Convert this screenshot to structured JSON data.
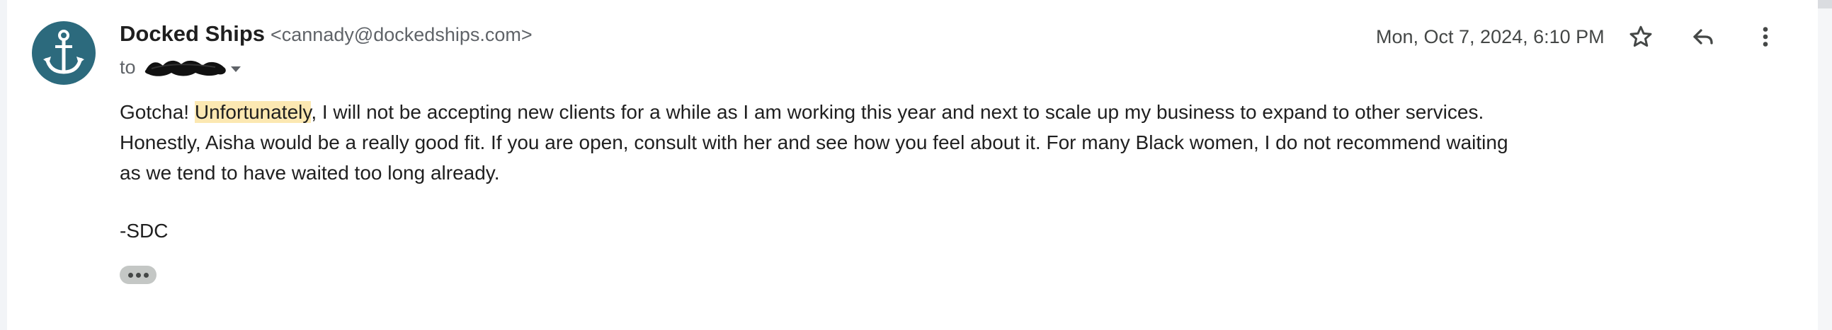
{
  "message": {
    "sender_name": "Docked Ships",
    "sender_email": "<cannady@dockedships.com>",
    "to_label": "to",
    "date": "Mon, Oct 7, 2024, 6:10 PM",
    "body": {
      "line1_before": "Gotcha! ",
      "line1_highlight": "Unfortunately",
      "line1_after": ", I will not be accepting new clients for a while as I am working this year and next to scale up my business to expand to other services.",
      "line2": "Honestly, Aisha would be a really good fit. If you are open, consult with her and see how you feel about it. For many Black women, I do not recommend waiting",
      "line3": "as we tend to have waited too long already."
    },
    "signature": "-SDC"
  },
  "icons": {
    "avatar": "anchor-icon",
    "star": "star-icon",
    "reply": "reply-icon",
    "more": "more-vert-icon",
    "show_trimmed": "ellipsis-icon",
    "recipient_dropdown": "chevron-down-icon"
  },
  "colors": {
    "avatar_bg": "#2c6a7d",
    "highlight": "#fce8b2",
    "text": "#1f1f1f",
    "muted": "#5f6368"
  }
}
